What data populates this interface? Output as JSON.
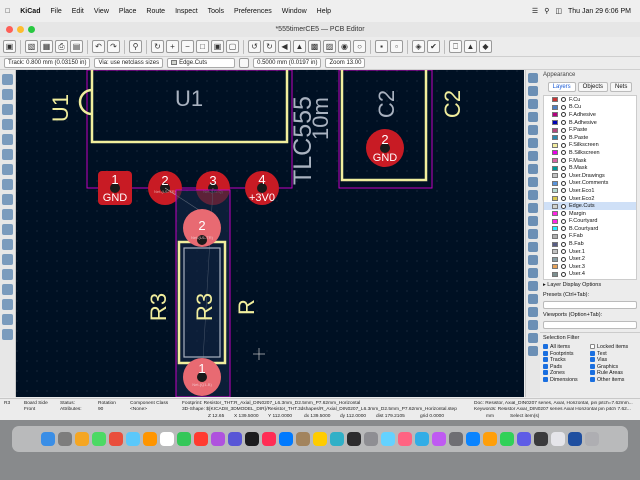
{
  "menubar": {
    "apple": "",
    "app": "KiCad",
    "items": [
      "File",
      "Edit",
      "View",
      "Place",
      "Route",
      "Inspect",
      "Tools",
      "Preferences",
      "Window",
      "Help"
    ],
    "clock": "Thu Jan 29  6:06 PM"
  },
  "window": {
    "title": "*555timerCE5 — PCB Editor"
  },
  "auxbar": {
    "track": "Track: 0.800 mm (0.03150 in)",
    "via": "Via: use netclass sizes",
    "layer": "Edge.Cuts",
    "grid": "0.5000 mm (0.0197 in)",
    "zoom": "Zoom 13.00"
  },
  "canvas": {
    "u1_ref": "U1",
    "u1_val": "U1",
    "tlc_a": "TLC555",
    "tlc_b": "10m",
    "c2_ref": "C2",
    "c2_side": "C2",
    "pads_u1": [
      {
        "num": "1",
        "net": "GND",
        "sub": ""
      },
      {
        "num": "2",
        "net": "",
        "sub": "Net-(U1-TR)"
      },
      {
        "num": "3",
        "net": "",
        "sub": "Net-(U1-Q)"
      },
      {
        "num": "4",
        "net": "+3V0",
        "sub": ""
      }
    ],
    "c2_pad": {
      "num": "2",
      "net": "GND"
    },
    "r3_pads": [
      {
        "num": "2",
        "sub": "Net-(U1-TR)"
      },
      {
        "num": "1",
        "sub": "Net-(Q1-B)"
      }
    ],
    "r3_ref_a": "R3",
    "r3_ref_b": "R3",
    "r3_val": "R"
  },
  "panel": {
    "title": "Appearance",
    "tabs": [
      "Layers",
      "Objects",
      "Nets"
    ],
    "layers": [
      {
        "name": "F.Cu",
        "color": "#c83434"
      },
      {
        "name": "B.Cu",
        "color": "#4d7fc4"
      },
      {
        "name": "F.Adhesive",
        "color": "#b3007f"
      },
      {
        "name": "B.Adhesive",
        "color": "#0000b5"
      },
      {
        "name": "F.Paste",
        "color": "#b4467b"
      },
      {
        "name": "B.Paste",
        "color": "#2c89b0"
      },
      {
        "name": "F.Silkscreen",
        "color": "#f2eda1"
      },
      {
        "name": "B.Silkscreen",
        "color": "#e800e8"
      },
      {
        "name": "F.Mask",
        "color": "#d864a4"
      },
      {
        "name": "B.Mask",
        "color": "#009999"
      },
      {
        "name": "User.Drawings",
        "color": "#c2c2c2"
      },
      {
        "name": "User.Comments",
        "color": "#5994dc"
      },
      {
        "name": "User.Eco1",
        "color": "#b4dbd2"
      },
      {
        "name": "User.Eco2",
        "color": "#d8c852"
      },
      {
        "name": "Edge.Cuts",
        "color": "#d0d2cd"
      },
      {
        "name": "Margin",
        "color": "#ff26e2"
      },
      {
        "name": "F.Courtyard",
        "color": "#ff26e2"
      },
      {
        "name": "B.Courtyard",
        "color": "#26e9ff"
      },
      {
        "name": "F.Fab",
        "color": "#afafaf"
      },
      {
        "name": "B.Fab",
        "color": "#585d84"
      },
      {
        "name": "User.1",
        "color": "#c2c2c2"
      },
      {
        "name": "User.2",
        "color": "#899ea4"
      },
      {
        "name": "User.3",
        "color": "#e5a25a"
      },
      {
        "name": "User.4",
        "color": "#7c8f8f"
      }
    ],
    "active_layer": "Edge.Cuts",
    "layer_display": "Layer Display Options",
    "presets": "Presets (Ctrl+Tab):",
    "viewports": "Viewports (Option+Tab):",
    "selection_filter": "Selection Filter",
    "filters": [
      {
        "label": "All items",
        "on": true
      },
      {
        "label": "Locked items",
        "on": false
      },
      {
        "label": "Footprints",
        "on": true
      },
      {
        "label": "Text",
        "on": true
      },
      {
        "label": "Tracks",
        "on": true
      },
      {
        "label": "Vias",
        "on": true
      },
      {
        "label": "Pads",
        "on": true
      },
      {
        "label": "Graphics",
        "on": true
      },
      {
        "label": "Zones",
        "on": true
      },
      {
        "label": "Rule Areas",
        "on": true
      },
      {
        "label": "Dimensions",
        "on": true
      },
      {
        "label": "Other items",
        "on": true
      }
    ]
  },
  "status": {
    "ref": "R3",
    "side_lbl": "Board Side",
    "side": "Front",
    "status_lbl": "Status:",
    "attr_lbl": "Attributes:",
    "rot_lbl": "Rotation",
    "rot": "90",
    "class_lbl": "Component Class",
    "class": "<None>",
    "fp": "Footprint: Resistor_THT:R_Axial_DIN0207_L6.3mm_D2.5mm_P7.62mm_Horizontal",
    "shape": "3D-Shape: ${KICAD8_3DMODEL_DIR}/Resistor_THT.3dshapes/R_Axial_DIN0207_L6.3mm_D2.5mm_P7.62mm_Horizontal.step",
    "doc": "Doc: Resistor, Axial_DIN0207 series, Axial, Horizontal, pin pitch=7.62mm...",
    "kw": "Keywords: Resistor Axial_DIN0207 series Axial Horizontal pin pitch 7.62...",
    "z": "Z 12.65",
    "x": "X 139.5000",
    "y": "Y 112.0000",
    "dx": "dx 139.5000",
    "dy": "dy 112.0000",
    "dist": "dist 179.2105",
    "grid": "grid 0.0000",
    "units": "mm",
    "mode": "Select item(s)"
  }
}
